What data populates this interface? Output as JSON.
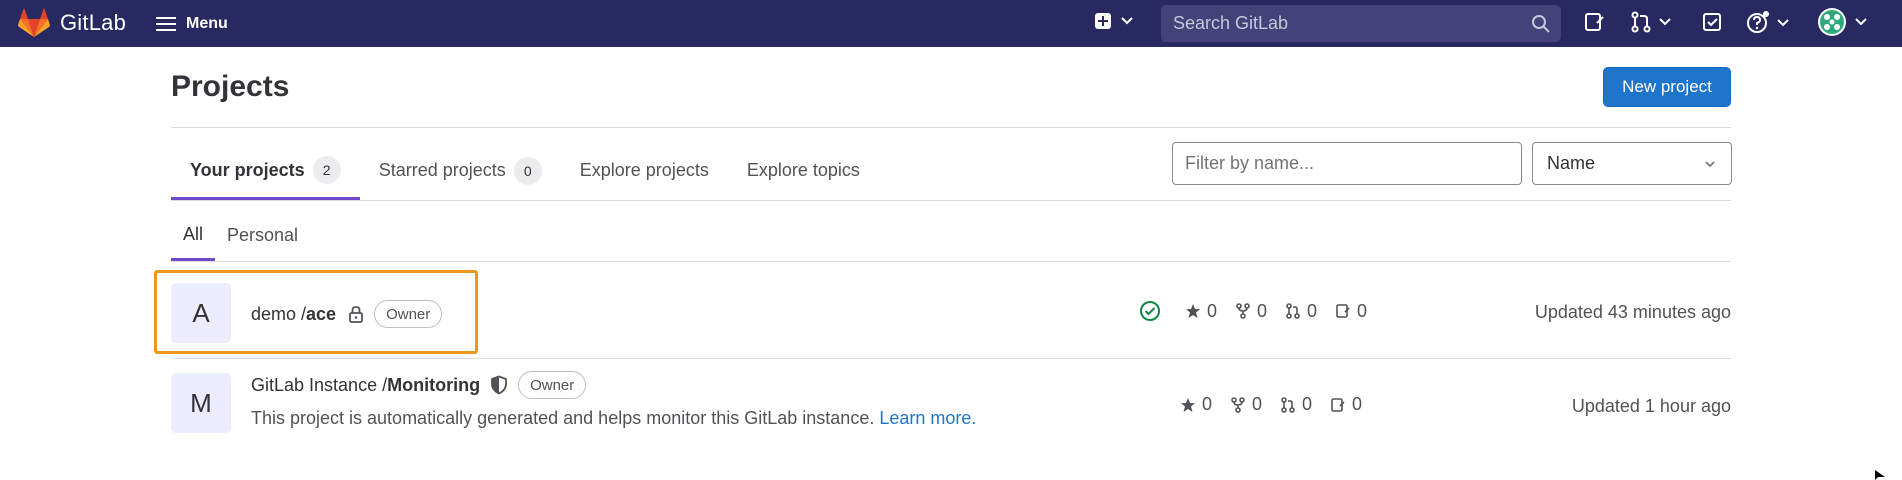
{
  "navbar": {
    "logo_text": "GitLab",
    "menu_label": "Menu",
    "search_placeholder": "Search GitLab",
    "bg_color": "#292961"
  },
  "page": {
    "title": "Projects",
    "new_project_label": "New project"
  },
  "tabs": [
    {
      "label": "Your projects",
      "count": "2",
      "active": true
    },
    {
      "label": "Starred projects",
      "count": "0",
      "active": false
    },
    {
      "label": "Explore projects",
      "count": null,
      "active": false
    },
    {
      "label": "Explore topics",
      "count": null,
      "active": false
    }
  ],
  "filter": {
    "placeholder": "Filter by name...",
    "sort_value": "Name"
  },
  "subtabs": [
    {
      "label": "All",
      "active": true
    },
    {
      "label": "Personal",
      "active": false
    }
  ],
  "projects": [
    {
      "avatar_letter": "A",
      "namespace": "demo / ",
      "name": "ace",
      "visibility_icon": "lock-icon",
      "role": "Owner",
      "pipeline_status": "success",
      "stars": "0",
      "forks": "0",
      "merge_requests": "0",
      "issues": "0",
      "updated": "Updated 43 minutes ago"
    },
    {
      "avatar_letter": "M",
      "namespace": "GitLab Instance / ",
      "name": "Monitoring",
      "visibility_icon": "shield-icon",
      "role": "Owner",
      "description": "This project is automatically generated and helps monitor this GitLab instance.",
      "description_link": "Learn more.",
      "stars": "0",
      "forks": "0",
      "merge_requests": "0",
      "issues": "0",
      "updated": "Updated 1 hour ago"
    }
  ],
  "colors": {
    "accent": "#6e49cb",
    "primary_button": "#1f75cb",
    "highlight": "#f0971b",
    "success": "#108548"
  }
}
